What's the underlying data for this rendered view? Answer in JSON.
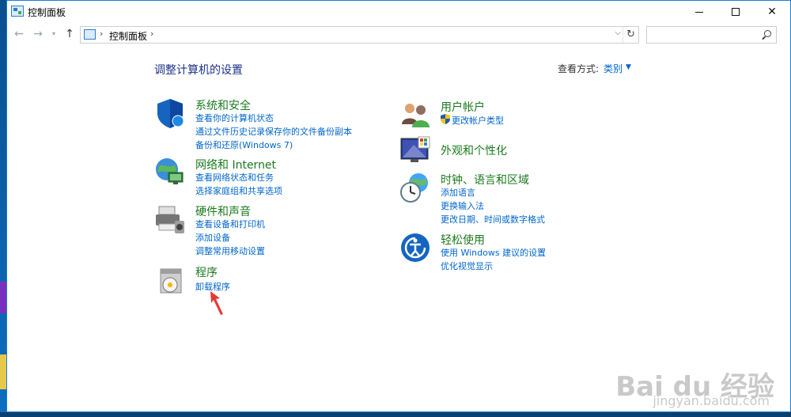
{
  "window": {
    "title": "控制面板",
    "minimize_glyph": "",
    "maximize_glyph": "",
    "close_glyph": "✕"
  },
  "nav": {
    "back": "←",
    "forward": "→",
    "recent": "▾",
    "up": "↑",
    "address_sep": "›",
    "address_text": "控制面板",
    "address_sep2": "›",
    "dropdown": "⌵",
    "refresh": "↻",
    "search_placeholder": ""
  },
  "main": {
    "heading": "调整计算机的设置",
    "view_by_label": "查看方式:",
    "view_by_value": "类别",
    "view_by_caret": "▼"
  },
  "categories": {
    "system": {
      "title": "系统和安全",
      "links": [
        "查看你的计算机状态",
        "通过文件历史记录保存你的文件备份副本",
        "备份和还原(Windows 7)"
      ]
    },
    "network": {
      "title": "网络和 Internet",
      "links": [
        "查看网络状态和任务",
        "选择家庭组和共享选项"
      ]
    },
    "hardware": {
      "title": "硬件和声音",
      "links": [
        "查看设备和打印机",
        "添加设备",
        "调整常用移动设置"
      ]
    },
    "programs": {
      "title": "程序",
      "links": [
        "卸载程序"
      ]
    },
    "users": {
      "title": "用户帐户",
      "links": [
        "更改帐户类型"
      ]
    },
    "appearance": {
      "title": "外观和个性化",
      "links": []
    },
    "clock": {
      "title": "时钟、语言和区域",
      "links": [
        "添加语言",
        "更换输入法",
        "更改日期、时间或数字格式"
      ]
    },
    "ease": {
      "title": "轻松使用",
      "links": [
        "使用 Windows 建议的设置",
        "优化视觉显示"
      ]
    }
  },
  "watermark": {
    "text": "Bai du 经验",
    "sub": "jingyan.baidu.com"
  },
  "colors": {
    "heading": "#1e3287",
    "category_title": "#1b7a1e",
    "link": "#0066cc",
    "desktop": "#0b5fa5"
  }
}
